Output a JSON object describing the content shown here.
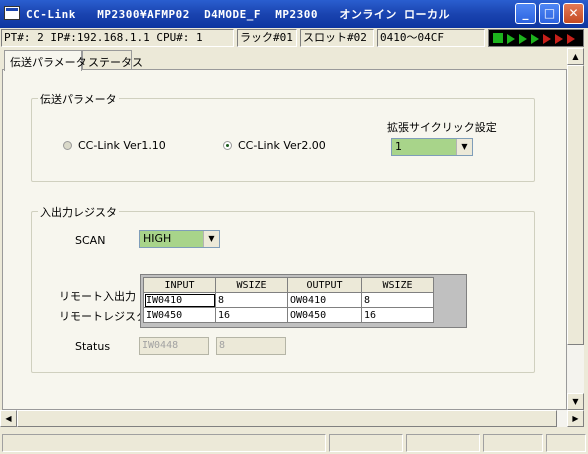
{
  "window": {
    "title": "CC-Link   MP2300¥AFMP02  D4MODE_F  MP2300   オンライン ローカル",
    "minimize": "_",
    "maximize": "□",
    "close": "✕",
    "icon": "app-window-icon"
  },
  "infobar": {
    "pt": "PT#: 2 IP#:192.168.1.1 CPU#: 1",
    "rack": "ラック#01",
    "slot": "スロット#02",
    "range": "0410～04CF",
    "lights": [
      "green",
      "green",
      "green",
      "red",
      "red",
      "red"
    ]
  },
  "tabs": [
    {
      "label": "伝送パラメータ",
      "active": true
    },
    {
      "label": "ステータス",
      "active": false
    }
  ],
  "transfer": {
    "group_label": "伝送パラメータ",
    "option_v110": "CC-Link Ver1.10",
    "option_v200": "CC-Link Ver2.00",
    "selected": "CC-Link Ver2.00",
    "ext_cyclic_label": "拡張サイクリック設定",
    "ext_cyclic_value": "1"
  },
  "io": {
    "group_label": "入出力レジスタ",
    "scan_label": "SCAN",
    "scan_value": "HIGH",
    "columns": [
      "INPUT",
      "WSIZE",
      "OUTPUT",
      "WSIZE"
    ],
    "row_labels": [
      "リモート入出力",
      "リモートレジスタ"
    ],
    "rows": [
      [
        "IW0410",
        "8",
        "OW0410",
        "8"
      ],
      [
        "IW0450",
        "16",
        "OW0450",
        "16"
      ]
    ],
    "status_label": "Status",
    "status_register": "IW0448",
    "status_size": "8"
  },
  "colors": {
    "titlebar": "#1A44B0",
    "combo_bg": "#A8D48A",
    "content_bg": "#F7F6EE"
  }
}
